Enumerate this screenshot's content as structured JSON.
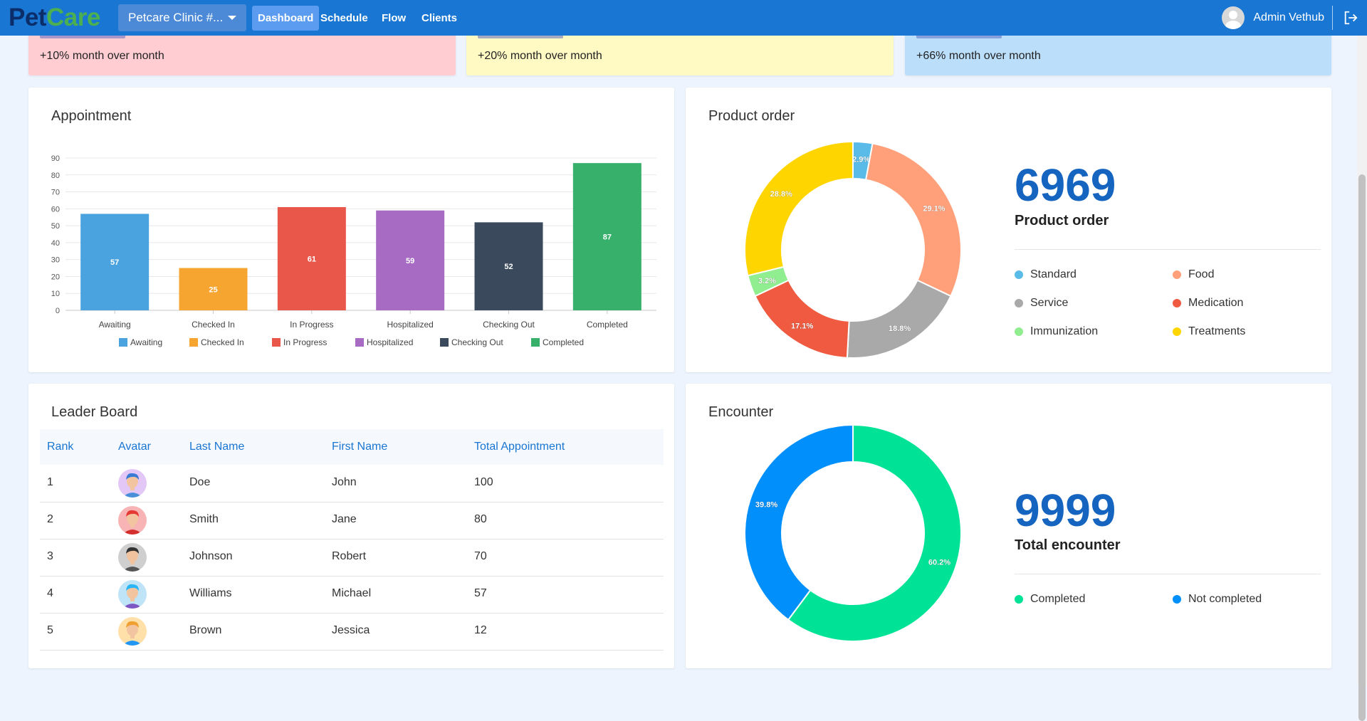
{
  "nav": {
    "logo_part1": "Pet",
    "logo_part2": "Care",
    "clinic_select": "Petcare Clinic #...",
    "links": [
      "Dashboard",
      "Schedule",
      "Flow",
      "Clients"
    ],
    "active": "Dashboard",
    "user_name": "Admin Vethub"
  },
  "stats": [
    {
      "delta": "+10% month over month",
      "bg": "#ffcdd2",
      "accent": "#5c6bc0"
    },
    {
      "delta": "+20% month over month",
      "bg": "#fff9c4",
      "accent": "#5c6bc0"
    },
    {
      "delta": "+66% month over month",
      "bg": "#bbdefb",
      "accent": "#5c6bc0"
    }
  ],
  "appointment": {
    "title": "Appointment",
    "chart_data": {
      "type": "bar",
      "categories": [
        "Awaiting",
        "Checked In",
        "In Progress",
        "Hospitalized",
        "Checking Out",
        "Completed"
      ],
      "values": [
        57,
        25,
        61,
        59,
        52,
        87
      ],
      "colors": [
        "#4aa3df",
        "#f5a530",
        "#e8574a",
        "#a76bc4",
        "#3a4a5c",
        "#36b06a"
      ],
      "yticks": [
        0,
        10,
        20,
        30,
        40,
        50,
        60,
        70,
        80,
        90
      ],
      "ylim": [
        0,
        90
      ],
      "legend": [
        "Awaiting",
        "Checked In",
        "In Progress",
        "Hospitalized",
        "Checking Out",
        "Completed"
      ],
      "legend_position": "bottom",
      "grid": true
    }
  },
  "product_order": {
    "title": "Product order",
    "total": "6969",
    "total_label": "Product order",
    "chart_data": {
      "type": "pie",
      "categories": [
        "Standard",
        "Food",
        "Service",
        "Medication",
        "Immunization",
        "Treatments"
      ],
      "values": [
        2.9,
        29.1,
        18.8,
        17.1,
        3.2,
        28.8
      ],
      "labels": [
        "2.9%",
        "29.1%",
        "18.8%",
        "17.1%",
        "3.2%",
        "28.8%"
      ],
      "colors": [
        "#5bbbe8",
        "#ffa07a",
        "#a9a9a9",
        "#f05a40",
        "#90ee90",
        "#ffd500"
      ]
    },
    "legend": [
      "Standard",
      "Food",
      "Service",
      "Medication",
      "Immunization",
      "Treatments"
    ]
  },
  "leaderboard": {
    "title": "Leader Board",
    "headers": [
      "Rank",
      "Avatar",
      "Last Name",
      "First Name",
      "Total Appointment"
    ],
    "rows": [
      {
        "rank": "1",
        "last": "Doe",
        "first": "John",
        "total": "100",
        "avatar_bg": "#e3c8f7",
        "skin": "#f2c4a0",
        "hair": "#3a7bd5",
        "shirt": "#4a90d9"
      },
      {
        "rank": "2",
        "last": "Smith",
        "first": "Jane",
        "total": "80",
        "avatar_bg": "#f8b4b4",
        "skin": "#f2c4a0",
        "hair": "#e53935",
        "shirt": "#d32f2f"
      },
      {
        "rank": "3",
        "last": "Johnson",
        "first": "Robert",
        "total": "70",
        "avatar_bg": "#cfcfcf",
        "skin": "#f0c29e",
        "hair": "#333333",
        "shirt": "#555555"
      },
      {
        "rank": "4",
        "last": "Williams",
        "first": "Michael",
        "total": "57",
        "avatar_bg": "#bfe3f7",
        "skin": "#f2c4a0",
        "hair": "#29b6f6",
        "shirt": "#7e57c2"
      },
      {
        "rank": "5",
        "last": "Brown",
        "first": "Jessica",
        "total": "12",
        "avatar_bg": "#ffe0a8",
        "skin": "#f2c4a0",
        "hair": "#f0a030",
        "shirt": "#2196f3"
      }
    ]
  },
  "encounter": {
    "title": "Encounter",
    "total": "9999",
    "total_label": "Total encounter",
    "chart_data": {
      "type": "pie",
      "categories": [
        "Completed",
        "Not completed"
      ],
      "values": [
        60.2,
        39.8
      ],
      "labels": [
        "60.2%",
        "39.8%"
      ],
      "colors": [
        "#00e396",
        "#008ffb"
      ]
    },
    "legend": [
      "Completed",
      "Not completed"
    ]
  }
}
